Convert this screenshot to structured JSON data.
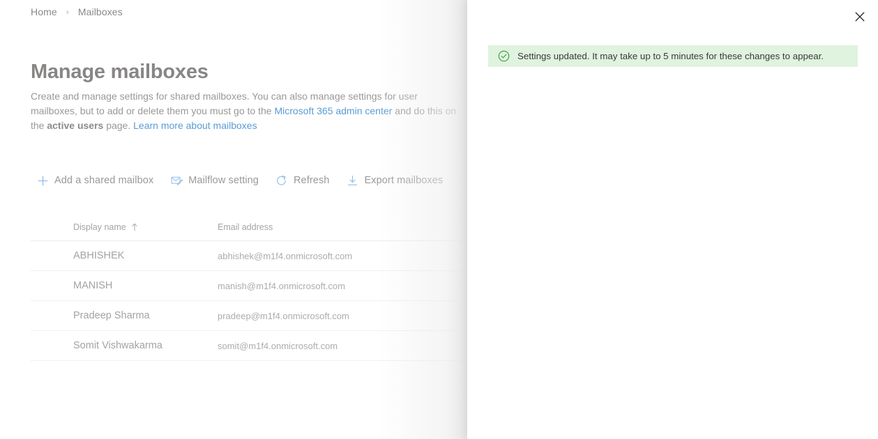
{
  "breadcrumb": {
    "items": [
      {
        "label": "Home",
        "link": true
      },
      {
        "label": "Mailboxes",
        "link": false
      }
    ],
    "separator": "›"
  },
  "page": {
    "title": "Manage mailboxes",
    "description": {
      "part1": "Create and manage settings for shared mailboxes. You can also manage settings for user mailboxes, but to add or delete them you must go to the ",
      "link1": "Microsoft 365 admin center",
      "part2": " and do this on the ",
      "bold1": "active users",
      "part3": " page. ",
      "link2": "Learn more about mailboxes"
    }
  },
  "toolbar": {
    "buttons": [
      {
        "label": "Add a shared mailbox",
        "icon": "add-icon"
      },
      {
        "label": "Mailflow setting",
        "icon": "mailflow-icon"
      },
      {
        "label": "Refresh",
        "icon": "refresh-icon"
      },
      {
        "label": "Export mailboxes",
        "icon": "download-icon"
      }
    ]
  },
  "table": {
    "columns": [
      {
        "header": "Display name",
        "sorted": true,
        "sort_direction": "ascending"
      },
      {
        "header": "Email address",
        "sorted": false,
        "sort_direction": ""
      }
    ],
    "rows": [
      {
        "display_name": "ABHISHEK",
        "email": "abhishek@m1f4.onmicrosoft.com"
      },
      {
        "display_name": "MANISH",
        "email": "manish@m1f4.onmicrosoft.com"
      },
      {
        "display_name": "Pradeep Sharma",
        "email": "pradeep@m1f4.onmicrosoft.com"
      },
      {
        "display_name": "Somit Vishwakarma",
        "email": "somit@m1f4.onmicrosoft.com"
      }
    ]
  },
  "panel": {
    "close_label": "Close",
    "notification": {
      "message": "Settings updated. It may take up to 5 minutes for these changes to appear.",
      "type": "success",
      "icon": "checkmark-circle-icon",
      "background_color": "#dff3df",
      "icon_color": "#3a9b35"
    }
  },
  "colors": {
    "accent_link": "#5b9bd5",
    "command_icon": "#93bde4",
    "text_muted": "#a5a3a1",
    "title": "#888685"
  }
}
